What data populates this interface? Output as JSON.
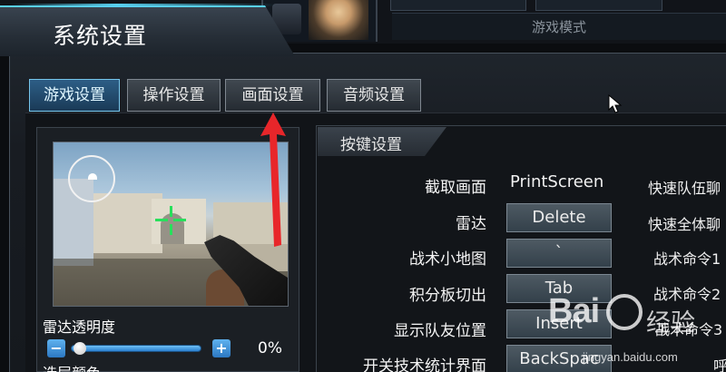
{
  "background": {
    "mode_label": "游戏模式"
  },
  "dialog": {
    "title": "系统设置"
  },
  "tabs": [
    {
      "label": "游戏设置",
      "active": true
    },
    {
      "label": "操作设置",
      "active": false
    },
    {
      "label": "画面设置",
      "active": false
    },
    {
      "label": "音频设置",
      "active": false
    }
  ],
  "preview": {
    "radar_transparency_label": "雷达透明度",
    "radar_transparency_value": "0%",
    "radar_transparency_level": 0,
    "team_color_label": "选层颜色"
  },
  "key_settings": {
    "header": "按键设置",
    "rows": [
      {
        "label": "截取画面",
        "key": "PrintScreen"
      },
      {
        "label": "雷达",
        "key": "Delete"
      },
      {
        "label": "战术小地图",
        "key": "`"
      },
      {
        "label": "积分板切出",
        "key": "Tab"
      },
      {
        "label": "显示队友位置",
        "key": "Insert"
      },
      {
        "label": "开关技术统计界面",
        "key": "BackSpac"
      }
    ],
    "right_labels": [
      "快速队伍聊",
      "快速全体聊",
      "战术命令1",
      "战术命令2",
      "战术命令3",
      "呼"
    ]
  },
  "watermark": {
    "logo": "Bai",
    "brand": "经验",
    "url": "jingyan.baidu.com"
  },
  "colors": {
    "accent": "#58d0f0",
    "active_tab": "#2d5e86",
    "slider": "#3b8fd8",
    "annotation_arrow": "#e8262a",
    "crosshair": "#27e05b"
  }
}
